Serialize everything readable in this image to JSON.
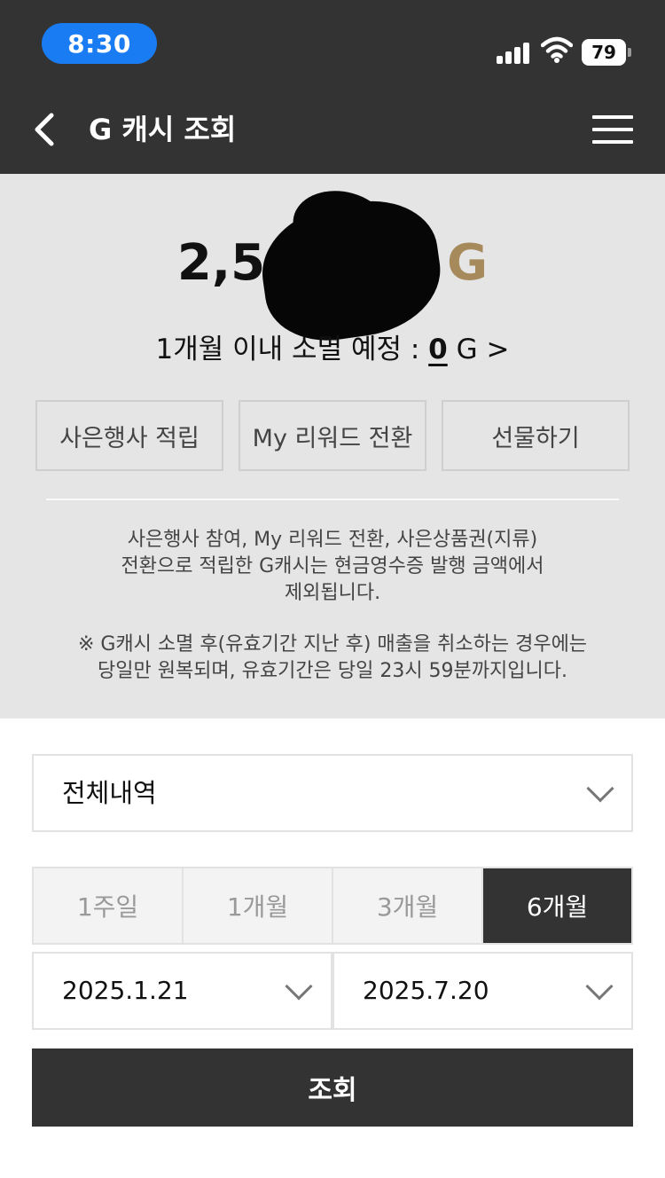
{
  "status_bar": {
    "time": "8:30",
    "battery": "79",
    "icons": [
      "signal-icon",
      "wifi-icon",
      "battery-icon"
    ]
  },
  "header": {
    "title": "G 캐시 조회",
    "back_icon": "chevron-left-icon",
    "menu_icon": "hamburger-menu-icon"
  },
  "summary": {
    "balance_prefix": "2,5",
    "balance_unit": "G",
    "expire_label": "1개월 이내 소멸 예정 :",
    "expire_value": "0",
    "expire_suffix": "G >",
    "actions": [
      "사은행사 적립",
      "My 리워드 전환",
      "선물하기"
    ],
    "notice_lines": [
      "사은행사 참여, My 리워드 전환, 사은상품권(지류)",
      "전환으로 적립한 G캐시는 현금영수증 발행 금액에서",
      "제외됩니다."
    ],
    "warning_lines": [
      "※ G캐시 소멸 후(유효기간 지난 후) 매출을 취소하는 경우에는",
      "당일만 원복되며, 유효기간은 당일 23시 59분까지입니다."
    ]
  },
  "filter": {
    "type_selected": "전체내역",
    "periods": [
      "1주일",
      "1개월",
      "3개월",
      "6개월"
    ],
    "active_period": "6개월",
    "start_date": "2025.1.21",
    "end_date": "2025.7.20",
    "search_label": "조회"
  },
  "colors": {
    "dark": "#333333",
    "panel": "#e5e5e5",
    "accent_gold": "#a68a5c",
    "time_pill": "#1a7cf2"
  }
}
